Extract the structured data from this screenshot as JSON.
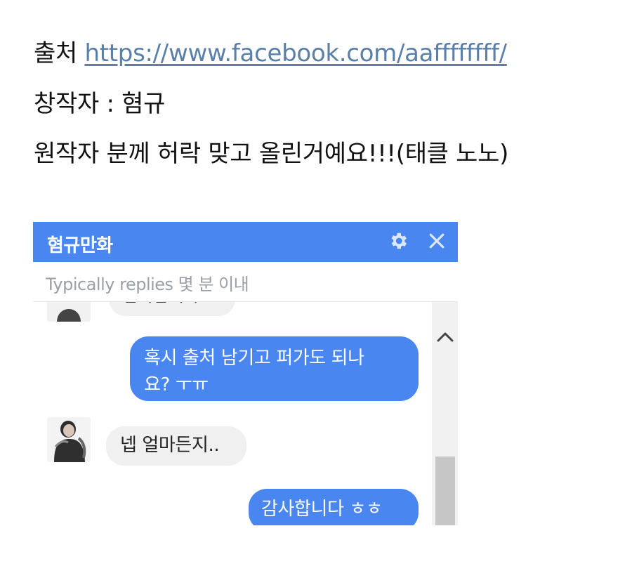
{
  "post": {
    "source_label": "출처",
    "source_url": "https://www.facebook.com/aaffffffff/",
    "creator_line": "창작자 : 혐규",
    "permission_line": "원작자 분께 허락 맞고 올린거예요!!!(태클 노노)"
  },
  "chat": {
    "title": "혐규만화",
    "subtitle": "Typically replies 몇 분 이내",
    "icons": {
      "settings": "gear-icon",
      "close": "close-icon",
      "scroll_up": "chevron-up-icon"
    },
    "colors": {
      "header": "#4a86f0",
      "outgoing_bubble": "#4a86f0",
      "incoming_bubble": "#f0f0f0"
    },
    "messages": [
      {
        "direction": "incoming",
        "text": "감사합니다..",
        "partial": true
      },
      {
        "direction": "outgoing",
        "text": "혹시 출처 남기고 퍼가도 되나\n요? ㅜㅠ"
      },
      {
        "direction": "incoming",
        "text": "넵 얼마든지.."
      },
      {
        "direction": "outgoing",
        "text": "감사합니다 ㅎㅎ"
      }
    ]
  }
}
